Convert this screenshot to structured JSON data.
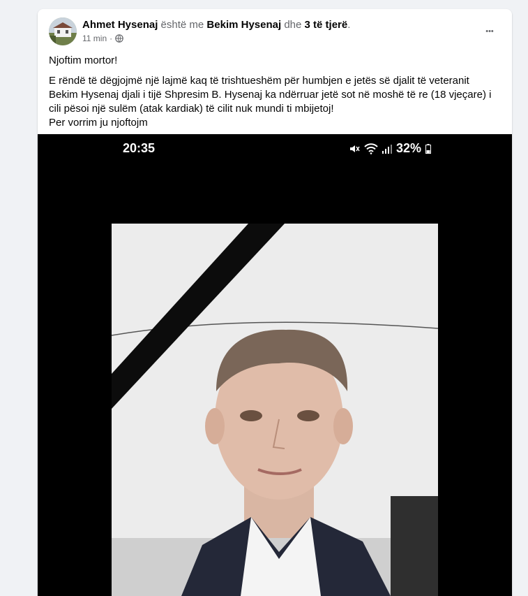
{
  "post": {
    "author": "Ahmet Hysenaj",
    "with_text": "është me",
    "tagged": "Bekim Hysenaj",
    "and_text": "dhe",
    "others": "3 të tjerë",
    "period": ".",
    "time": "11 min",
    "dot": "·",
    "more_label": "•••",
    "line1": "Njoftim mortor!",
    "line2": "E rëndë të dëgjojmë një lajmë kaq të trishtueshëm për humbjen e jetës së djalit të veteranit Bekim Hysenaj djali i tijë Shpresim B. Hysenaj ka ndërruar jetë sot në moshë të re (18 vjeçare) i cili pësoi një sulëm (atak kardiak) të cilit nuk mundi ti mbijetoj!",
    "line3": "Per vorrim ju njoftojm"
  },
  "phone_status": {
    "time": "20:35",
    "battery": "32%",
    "icons": [
      "mute-icon",
      "wifi-icon",
      "signal-icon",
      "battery-icon"
    ]
  },
  "icons": {
    "privacy": "globe-icon"
  }
}
